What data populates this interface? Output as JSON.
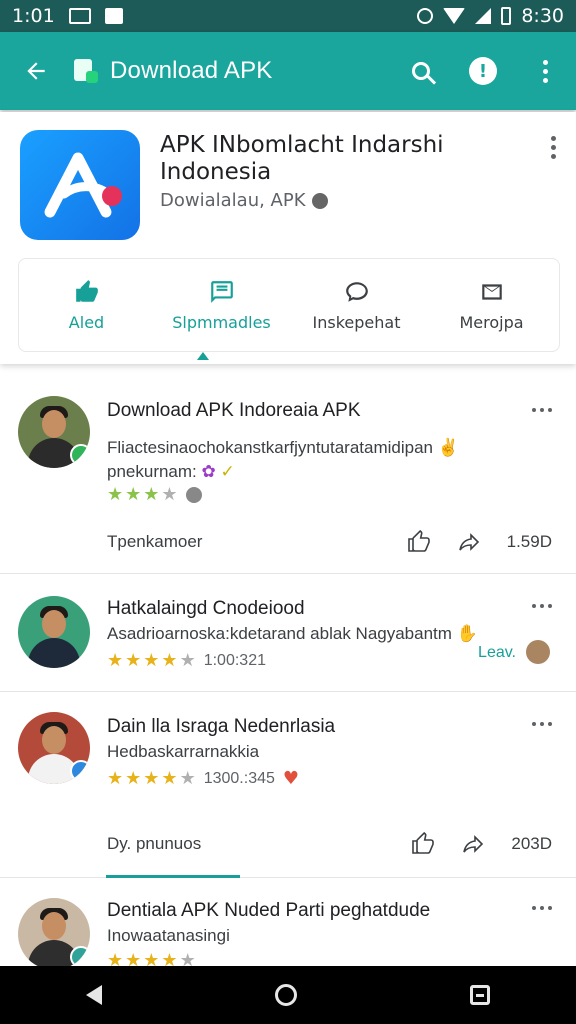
{
  "status_bar": {
    "time": "1:01",
    "right_time": "8:30"
  },
  "app_bar": {
    "title": "Download APK"
  },
  "header": {
    "app_name": "APK INbomlacht Indarshi Indonesia",
    "subtitle": "Dowialalau, APK",
    "actions": [
      {
        "label": "Aled",
        "icon": "thumbs-up-icon"
      },
      {
        "label": "Slpmmadles",
        "icon": "chat-icon"
      },
      {
        "label": "Inskepehat",
        "icon": "comment-icon"
      },
      {
        "label": "Merojpa",
        "icon": "mail-icon"
      }
    ]
  },
  "posts": [
    {
      "title": "Download APK Indoreaia APK",
      "body_line1": "Fliactesinaochokanstkarfjyntutaratamidipan",
      "body_line2": "pnekurnam:",
      "rating": 3,
      "meta": "",
      "footer_label": "Tpenkamoer",
      "count": "1.59D"
    },
    {
      "title": "Hatkalaingd Cnodeiood",
      "body_line1": "Asadrioarnoska:kdetarand ablak Nagyabantm",
      "body_line2": "",
      "rating": 4,
      "meta": "1:00:321",
      "side_tag": "Leav."
    },
    {
      "title": "Dain lla Israga Nedenrlasia",
      "body_line1": "Hedbaskarrarnakkia",
      "body_line2": "",
      "rating": 4,
      "meta": "1300.:345",
      "footer_label": "Dy. pnunuos",
      "count": "203D"
    },
    {
      "title": "Dentiala APK Nuded Parti peghatdude",
      "body_line1": "Inowaatanasingi",
      "body_line2": "",
      "rating": 4,
      "meta": ""
    }
  ],
  "colors": {
    "status_bar": "#1c5b57",
    "app_bar": "#1aa69d",
    "accent": "#16a098",
    "star": "#e8b21a"
  }
}
